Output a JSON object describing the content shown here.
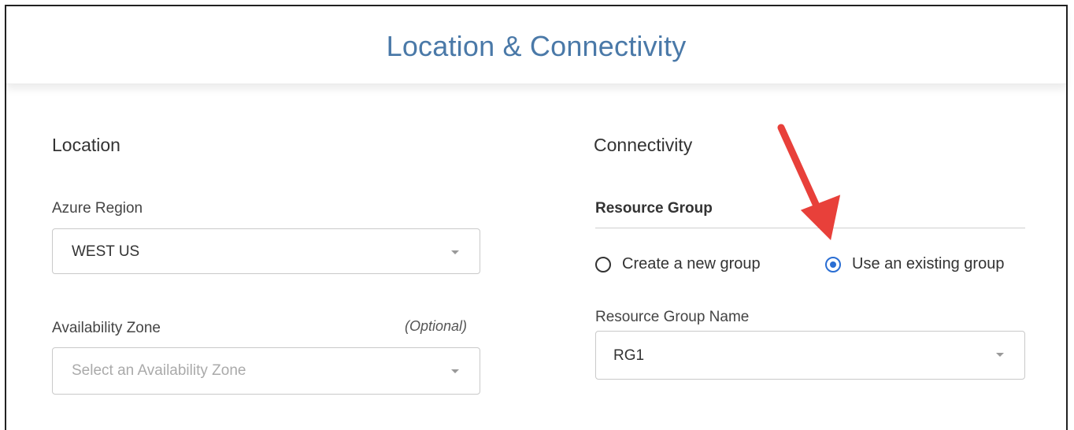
{
  "header": {
    "title": "Location & Connectivity"
  },
  "location": {
    "title": "Location",
    "azure_region": {
      "label": "Azure Region",
      "value": "WEST US"
    },
    "availability_zone": {
      "label": "Availability Zone",
      "optional": "(Optional)",
      "placeholder": "Select an Availability Zone"
    }
  },
  "connectivity": {
    "title": "Connectivity",
    "resource_group": {
      "label": "Resource Group",
      "options": [
        {
          "label": "Create a new group",
          "selected": false
        },
        {
          "label": "Use an existing group",
          "selected": true
        }
      ],
      "name_label": "Resource Group Name",
      "name_value": "RG1"
    }
  },
  "colors": {
    "title": "#4a79a8",
    "radio_selected": "#2a6ed3",
    "annotation_arrow": "#e8403a"
  }
}
